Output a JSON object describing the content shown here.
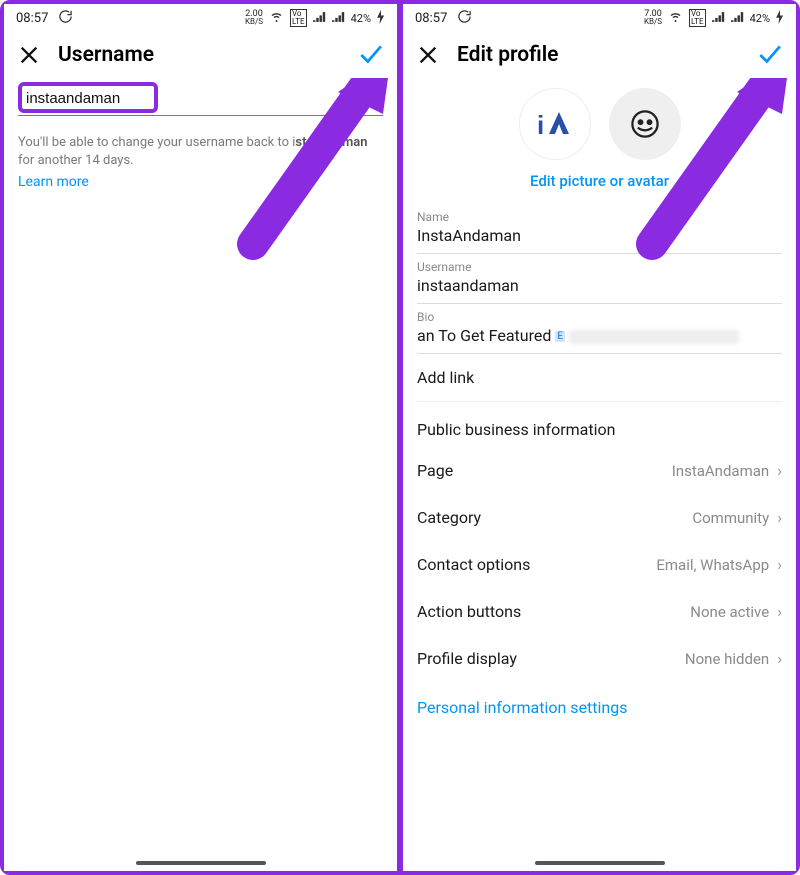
{
  "status": {
    "time": "08:57",
    "net_left": "2.00",
    "net_right": "7.00",
    "net_unit": "KB/S",
    "battery": "42%"
  },
  "left": {
    "title": "Username",
    "username": "instaandaman",
    "hint_pre": "You'll be able to change your username back to i",
    "hint_bold": "staandaman",
    "hint_post": " for another 14 days.",
    "learn": "Learn more"
  },
  "right": {
    "title": "Edit profile",
    "editpic": "Edit picture or avatar",
    "name_lbl": "Name",
    "name_val": "InstaAndaman",
    "user_lbl": "Username",
    "user_val": "instaandaman",
    "bio_lbl": "Bio",
    "bio_val": "an To Get Featured ",
    "addlink": "Add link",
    "section": "Public business information",
    "rows": {
      "page_l": "Page",
      "page_v": "InstaAndaman",
      "cat_l": "Category",
      "cat_v": "Community",
      "contact_l": "Contact options",
      "contact_v": "Email, WhatsApp",
      "action_l": "Action buttons",
      "action_v": "None active",
      "profile_l": "Profile display",
      "profile_v": "None hidden"
    },
    "pis": "Personal information settings"
  }
}
